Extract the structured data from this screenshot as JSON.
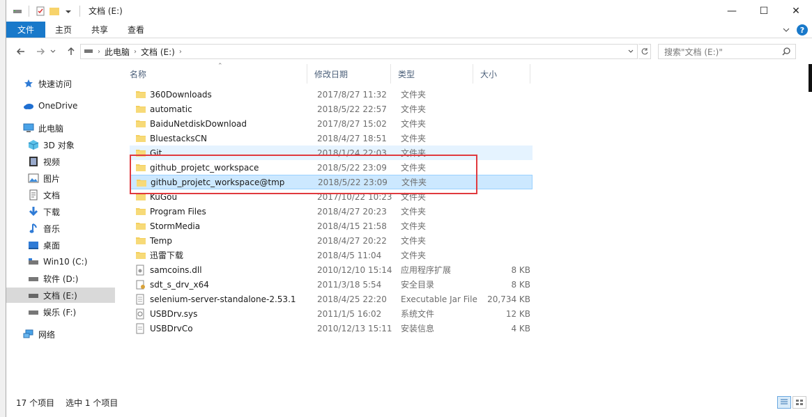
{
  "window": {
    "title": "文档 (E:)",
    "controls": {
      "minimize": "—",
      "maximize": "☐",
      "close": "✕"
    }
  },
  "ribbon": {
    "tabs": [
      "文件",
      "主页",
      "共享",
      "查看"
    ],
    "help": "?"
  },
  "address": {
    "crumbs": [
      "此电脑",
      "文档 (E:)"
    ],
    "search_placeholder": "搜索\"文档 (E:)\""
  },
  "nav": {
    "items": [
      {
        "label": "快速访问",
        "icon": "star-icon"
      },
      {
        "label": "OneDrive",
        "icon": "cloud-icon"
      },
      {
        "label": "此电脑",
        "icon": "pc-icon"
      },
      {
        "label": "3D 对象",
        "icon": "cube-icon"
      },
      {
        "label": "视频",
        "icon": "video-icon"
      },
      {
        "label": "图片",
        "icon": "picture-icon"
      },
      {
        "label": "文档",
        "icon": "document-icon"
      },
      {
        "label": "下载",
        "icon": "download-icon"
      },
      {
        "label": "音乐",
        "icon": "music-icon"
      },
      {
        "label": "桌面",
        "icon": "desktop-icon"
      },
      {
        "label": "Win10 (C:)",
        "icon": "drive-icon"
      },
      {
        "label": "软件 (D:)",
        "icon": "drive-icon"
      },
      {
        "label": "文档 (E:)",
        "icon": "drive-icon"
      },
      {
        "label": "娱乐 (F:)",
        "icon": "drive-icon"
      },
      {
        "label": "网络",
        "icon": "network-icon"
      }
    ]
  },
  "columns": {
    "name": "名称",
    "date": "修改日期",
    "type": "类型",
    "size": "大小"
  },
  "files": [
    {
      "name": "360Downloads",
      "date": "2017/8/27 11:32",
      "type": "文件夹",
      "size": "",
      "icon": "folder-icon"
    },
    {
      "name": "automatic",
      "date": "2018/5/22 22:57",
      "type": "文件夹",
      "size": "",
      "icon": "folder-icon"
    },
    {
      "name": "BaiduNetdiskDownload",
      "date": "2017/8/27 15:02",
      "type": "文件夹",
      "size": "",
      "icon": "folder-icon"
    },
    {
      "name": "BluestacksCN",
      "date": "2018/4/27 18:51",
      "type": "文件夹",
      "size": "",
      "icon": "folder-icon"
    },
    {
      "name": "Git",
      "date": "2018/1/24 22:03",
      "type": "文件夹",
      "size": "",
      "icon": "folder-icon"
    },
    {
      "name": "github_projetc_workspace",
      "date": "2018/5/22 23:09",
      "type": "文件夹",
      "size": "",
      "icon": "folder-icon"
    },
    {
      "name": "github_projetc_workspace@tmp",
      "date": "2018/5/22 23:09",
      "type": "文件夹",
      "size": "",
      "icon": "folder-icon"
    },
    {
      "name": "KuGou",
      "date": "2017/10/22 10:23",
      "type": "文件夹",
      "size": "",
      "icon": "folder-icon"
    },
    {
      "name": "Program Files",
      "date": "2018/4/27 20:23",
      "type": "文件夹",
      "size": "",
      "icon": "folder-icon"
    },
    {
      "name": "StormMedia",
      "date": "2018/4/15 21:58",
      "type": "文件夹",
      "size": "",
      "icon": "folder-icon"
    },
    {
      "name": "Temp",
      "date": "2018/4/27 20:22",
      "type": "文件夹",
      "size": "",
      "icon": "folder-icon"
    },
    {
      "name": "迅雷下载",
      "date": "2018/4/5 11:04",
      "type": "文件夹",
      "size": "",
      "icon": "folder-icon"
    },
    {
      "name": "samcoins.dll",
      "date": "2010/12/10 15:14",
      "type": "应用程序扩展",
      "size": "8 KB",
      "icon": "dll-file-icon"
    },
    {
      "name": "sdt_s_drv_x64",
      "date": "2011/3/18 5:54",
      "type": "安全目录",
      "size": "8 KB",
      "icon": "security-catalog-icon"
    },
    {
      "name": "selenium-server-standalone-2.53.1",
      "date": "2018/4/25 22:20",
      "type": "Executable Jar File",
      "size": "20,734 KB",
      "icon": "jar-file-icon"
    },
    {
      "name": "USBDrv.sys",
      "date": "2011/1/5 16:02",
      "type": "系统文件",
      "size": "12 KB",
      "icon": "sys-file-icon"
    },
    {
      "name": "USBDrvCo",
      "date": "2010/12/13 15:11",
      "type": "安装信息",
      "size": "4 KB",
      "icon": "inf-file-icon"
    }
  ],
  "status": {
    "count": "17 个项目",
    "selection": "选中 1 个项目"
  },
  "colors": {
    "accent": "#1979ca",
    "selected": "#cce8ff",
    "hover": "#e5f3ff",
    "highlight": "#e0393e"
  }
}
